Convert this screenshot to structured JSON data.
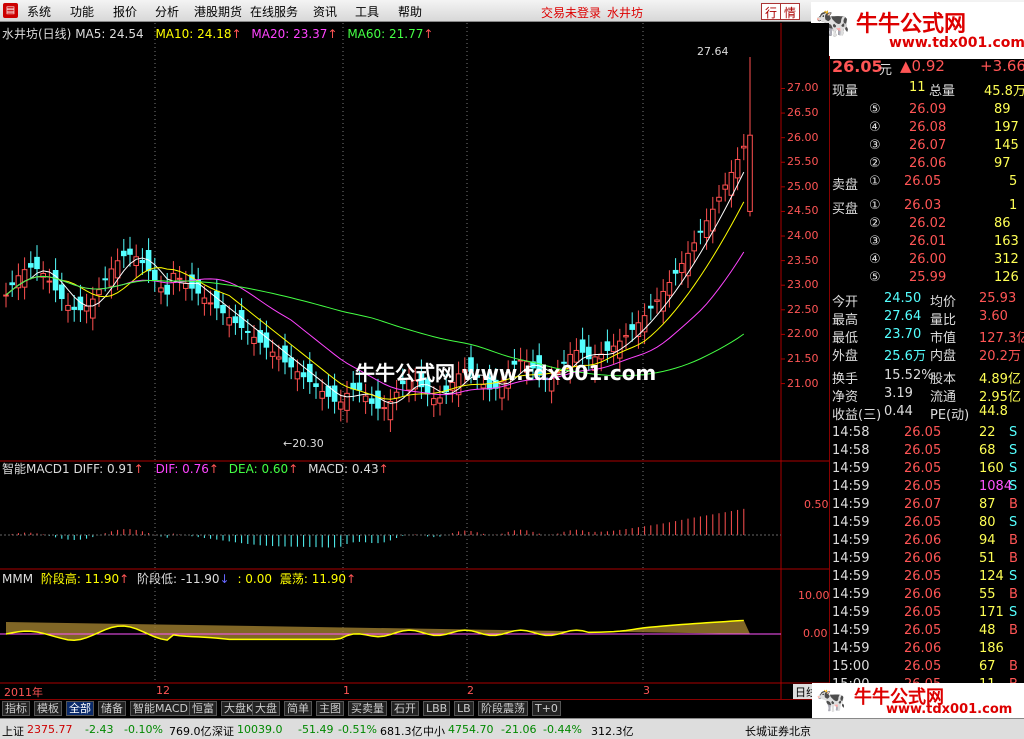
{
  "menu": {
    "items": [
      "系统",
      "功能",
      "报价",
      "分析",
      "港股期货",
      "在线服务",
      "资讯",
      "工具",
      "帮助"
    ],
    "warning": "交易未登录",
    "stock_link": "水井坊",
    "btn_trade": "行",
    "btn_info": "情"
  },
  "watermark": {
    "title": "牛牛公式网",
    "url": "www.tdx001.com",
    "center": "牛牛公式网 www.tdx001.com"
  },
  "chart_header": {
    "name": "水井坊(日线)",
    "ma5": "MA5: 24.54",
    "ma10": "MA10: 24.18",
    "ma20": "MA20: 23.37",
    "ma60": "MA60: 21.77"
  },
  "chart_annotations": {
    "high": "27.64",
    "low": "←20.30"
  },
  "macd_header": {
    "name": "智能MACD1",
    "diff_label": "DIFF: 0.91",
    "dif": "DIF: 0.76",
    "dea": "DEA: 0.60",
    "macd": "MACD: 0.43"
  },
  "mmm_header": {
    "name": "MMM",
    "high": "阶段高: 11.90",
    "low": "阶段低: -11.90",
    "zero": ": 0.00",
    "vol": "震荡: 11.90"
  },
  "axis": {
    "price": [
      "27.00",
      "26.50",
      "26.00",
      "25.50",
      "25.00",
      "24.50",
      "24.00",
      "23.50",
      "23.00",
      "22.50",
      "22.00",
      "21.50",
      "21.00"
    ],
    "macd": [
      "0.50"
    ],
    "mmm": [
      "10.00",
      "0.00"
    ],
    "dates": [
      "2011年",
      "12",
      "1",
      "2",
      "3"
    ],
    "period": "日线"
  },
  "chart_data": {
    "type": "candlestick",
    "title": "水井坊(日线)",
    "series": [
      {
        "name": "MA5",
        "last": 24.54
      },
      {
        "name": "MA10",
        "last": 24.18
      },
      {
        "name": "MA20",
        "last": 23.37
      },
      {
        "name": "MA60",
        "last": 21.77
      }
    ],
    "high": 27.64,
    "low": 20.3,
    "ylim": [
      20.3,
      27.64
    ]
  },
  "quote": {
    "price": "26.05",
    "unit": "元",
    "change": "▲0.92",
    "pct": "+3.66",
    "row_xl": [
      "现量",
      "11",
      "总量",
      "45.8万"
    ],
    "asks": [
      [
        "⑤",
        "26.09",
        "89"
      ],
      [
        "④",
        "26.08",
        "197"
      ],
      [
        "③",
        "26.07",
        "145"
      ],
      [
        "②",
        "26.06",
        "97"
      ]
    ],
    "ask1": [
      "卖盘",
      "①",
      "26.05",
      "5"
    ],
    "bid1": [
      "买盘",
      "①",
      "26.03",
      "1"
    ],
    "bids": [
      [
        "②",
        "26.02",
        "86"
      ],
      [
        "③",
        "26.01",
        "163"
      ],
      [
        "④",
        "26.00",
        "312"
      ],
      [
        "⑤",
        "25.99",
        "126"
      ]
    ],
    "stats": [
      [
        "今开",
        "24.50",
        "均价",
        "25.93"
      ],
      [
        "最高",
        "27.64",
        "量比",
        "3.60"
      ],
      [
        "最低",
        "23.70",
        "市值",
        "127.3亿"
      ],
      [
        "外盘",
        "25.6万",
        "内盘",
        "20.2万"
      ]
    ],
    "stats2": [
      [
        "换手",
        "15.52%",
        "股本",
        "4.89亿"
      ],
      [
        "净资",
        "3.19",
        "流通",
        "2.95亿"
      ],
      [
        "收益(三)",
        "0.44",
        "PE(动)",
        "44.8"
      ]
    ],
    "ticks": [
      [
        "14:58",
        "26.05",
        "22",
        "S"
      ],
      [
        "14:58",
        "26.05",
        "68",
        "S"
      ],
      [
        "14:59",
        "26.05",
        "160",
        "S"
      ],
      [
        "14:59",
        "26.05",
        "1084",
        "S"
      ],
      [
        "14:59",
        "26.07",
        "87",
        "B"
      ],
      [
        "14:59",
        "26.05",
        "80",
        "S"
      ],
      [
        "14:59",
        "26.06",
        "94",
        "B"
      ],
      [
        "14:59",
        "26.06",
        "51",
        "B"
      ],
      [
        "14:59",
        "26.05",
        "124",
        "S"
      ],
      [
        "14:59",
        "26.06",
        "55",
        "B"
      ],
      [
        "14:59",
        "26.05",
        "171",
        "S"
      ],
      [
        "14:59",
        "26.05",
        "48",
        "B"
      ],
      [
        "14:59",
        "26.06",
        "186",
        ""
      ],
      [
        "15:00",
        "26.05",
        "67",
        "B"
      ],
      [
        "15:00",
        "26.05",
        "11",
        "B"
      ]
    ]
  },
  "tabs": [
    "指标",
    "模板",
    "全部",
    "储备",
    "智能MACD1",
    "恒富",
    "大盘K",
    "大盘",
    "简单",
    "主图",
    "买卖量",
    "石开",
    "LBB",
    "LB",
    "阶段震荡",
    "T+0"
  ],
  "status": {
    "sh_label": "上证",
    "sh": "2375.77",
    "sh_chg": "-2.43",
    "sh_pct": "-0.10%",
    "sh_amt": "769.0亿",
    "sz_label": "深证",
    "sz": "10039.0",
    "sz_chg": "-51.49",
    "sz_pct": "-0.51%",
    "sz_amt": "681.3亿",
    "zx_label": "中小",
    "zx": "4754.70",
    "zx_chg": "-21.06",
    "zx_pct": "-0.44%",
    "zx_amt": "312.3亿",
    "broker": "长城证券北京"
  }
}
